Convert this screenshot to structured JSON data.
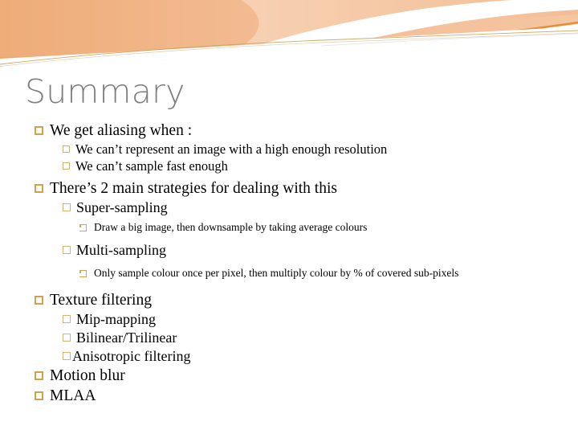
{
  "slide": {
    "title": "Summary",
    "background_color": "#ffffff",
    "title_color": "#7f7f7f",
    "accent_color": "#f0b384",
    "accent_dark_color": "#e8963f",
    "bullet_color": "#d4a14b",
    "bullet_color_level2": "#d9b277",
    "bullet_color_level3": "#d9a24f"
  },
  "decoration": {
    "name": "orange-swoosh-header",
    "band_color": "#f0b384",
    "band_light_color": "#f6cba8",
    "edge_line_color": "#e8963f",
    "thin_line_color": "#c59a4e"
  },
  "outline": [
    {
      "level": 1,
      "text": "We get aliasing when :"
    },
    {
      "level": 2,
      "text": "We can’t represent an image with a high enough resolution"
    },
    {
      "level": 2,
      "text": "We can’t sample fast enough"
    },
    {
      "level": 1,
      "text": "There’s 2 main strategies for dealing with this"
    },
    {
      "level": 2,
      "text": "Super-sampling"
    },
    {
      "level": 3,
      "text": "Draw a big image, then downsample by taking average colours"
    },
    {
      "level": 2,
      "text": "Multi-sampling"
    },
    {
      "level": 3,
      "text": "Only sample colour once per pixel, then multiply colour by % of covered sub-pixels"
    },
    {
      "level": 1,
      "text": "Texture filtering"
    },
    {
      "level": 2,
      "text": "Mip-mapping"
    },
    {
      "level": 2,
      "text": "Bilinear/Trilinear"
    },
    {
      "level": 2,
      "text": "Anisotropic filtering"
    },
    {
      "level": 1,
      "text": "Motion blur"
    },
    {
      "level": 1,
      "text": "MLAA"
    }
  ]
}
